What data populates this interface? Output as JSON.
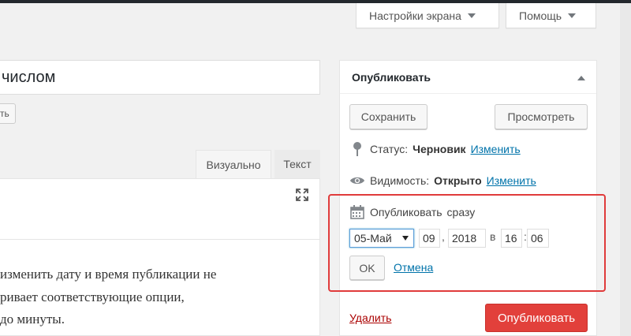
{
  "header": {
    "screen_options_label": "Настройки экрана",
    "help_label": "Помощь"
  },
  "post": {
    "title_fragment": "числом",
    "small_button_fragment": "ть"
  },
  "editor": {
    "tabs": [
      {
        "label": "Визуально"
      },
      {
        "label": "Текст"
      }
    ],
    "lines": [
      "изменить дату и время публикации не",
      "ривает соответствующие опции,",
      "до минуты."
    ]
  },
  "publish": {
    "title": "Опубликовать",
    "save_draft_label": "Сохранить",
    "preview_label": "Просмотреть",
    "status": {
      "label": "Статус:",
      "value": "Черновик",
      "edit": "Изменить"
    },
    "visibility": {
      "label": "Видимость:",
      "value": "Открыто",
      "edit": "Изменить"
    },
    "schedule": {
      "label": "Опубликовать",
      "value": "сразу"
    },
    "date": {
      "month": "05-Май",
      "day": "09",
      "year": "2018",
      "at": "в",
      "hour": "16",
      "minute": "06",
      "comma": ",",
      "colon": ":"
    },
    "ok_label": "OK",
    "cancel_label": "Отмена",
    "delete_label": "Удалить",
    "publish_label": "Опубликовать"
  },
  "colors": {
    "accent_link": "#0073aa",
    "publish_button": "#e2403b",
    "highlight_border": "#e03b3b",
    "delete_link": "#aa0000"
  }
}
